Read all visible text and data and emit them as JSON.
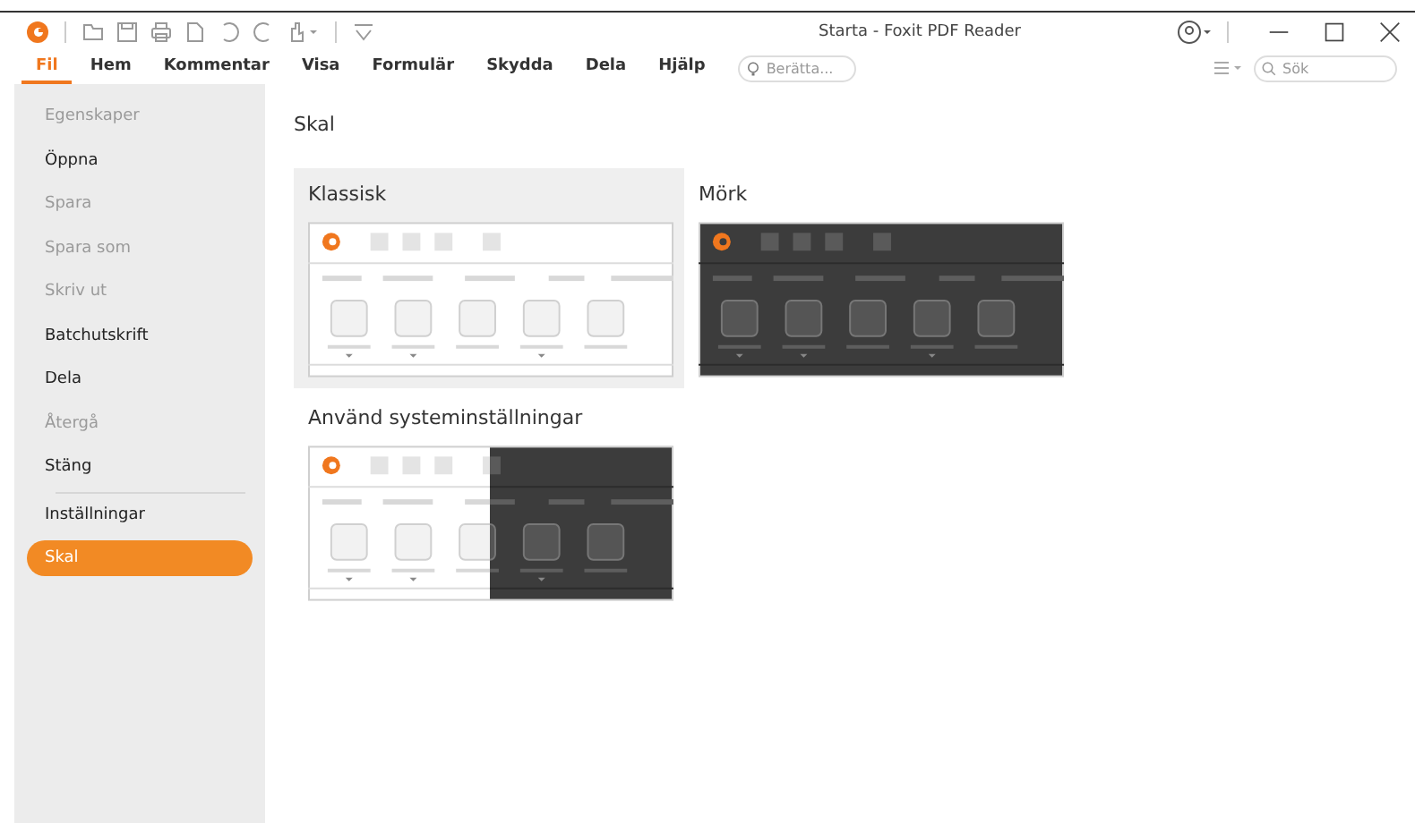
{
  "window": {
    "title": "Starta - Foxit PDF Reader"
  },
  "tabs": [
    {
      "label": "Fil",
      "selected": true
    },
    {
      "label": "Hem",
      "selected": false
    },
    {
      "label": "Kommentar",
      "selected": false
    },
    {
      "label": "Visa",
      "selected": false
    },
    {
      "label": "Formulär",
      "selected": false
    },
    {
      "label": "Skydda",
      "selected": false
    },
    {
      "label": "Dela",
      "selected": false
    },
    {
      "label": "Hjälp",
      "selected": false
    }
  ],
  "tell_me": {
    "placeholder": "Berätta..."
  },
  "search": {
    "placeholder": "Sök"
  },
  "sidebar": {
    "items": [
      {
        "label": "Egenskaper",
        "disabled": true,
        "selected": false,
        "separator_before": false
      },
      {
        "label": "Öppna",
        "disabled": false,
        "selected": false,
        "separator_before": false
      },
      {
        "label": "Spara",
        "disabled": true,
        "selected": false,
        "separator_before": false
      },
      {
        "label": "Spara som",
        "disabled": true,
        "selected": false,
        "separator_before": false
      },
      {
        "label": "Skriv ut",
        "disabled": true,
        "selected": false,
        "separator_before": false
      },
      {
        "label": "Batchutskrift",
        "disabled": false,
        "selected": false,
        "separator_before": false
      },
      {
        "label": "Dela",
        "disabled": false,
        "selected": false,
        "separator_before": false
      },
      {
        "label": "Återgå",
        "disabled": true,
        "selected": false,
        "separator_before": false
      },
      {
        "label": "Stäng",
        "disabled": false,
        "selected": false,
        "separator_before": false
      },
      {
        "label": "Inställningar",
        "disabled": false,
        "selected": false,
        "separator_before": true
      },
      {
        "label": "Skal",
        "disabled": false,
        "selected": true,
        "separator_before": false
      }
    ]
  },
  "content": {
    "heading": "Skal",
    "themes": [
      {
        "label": "Klassisk",
        "kind": "light",
        "selected": true
      },
      {
        "label": "Mörk",
        "kind": "dark",
        "selected": false
      },
      {
        "label": "Använd systeminställningar",
        "kind": "system",
        "selected": false
      }
    ]
  }
}
